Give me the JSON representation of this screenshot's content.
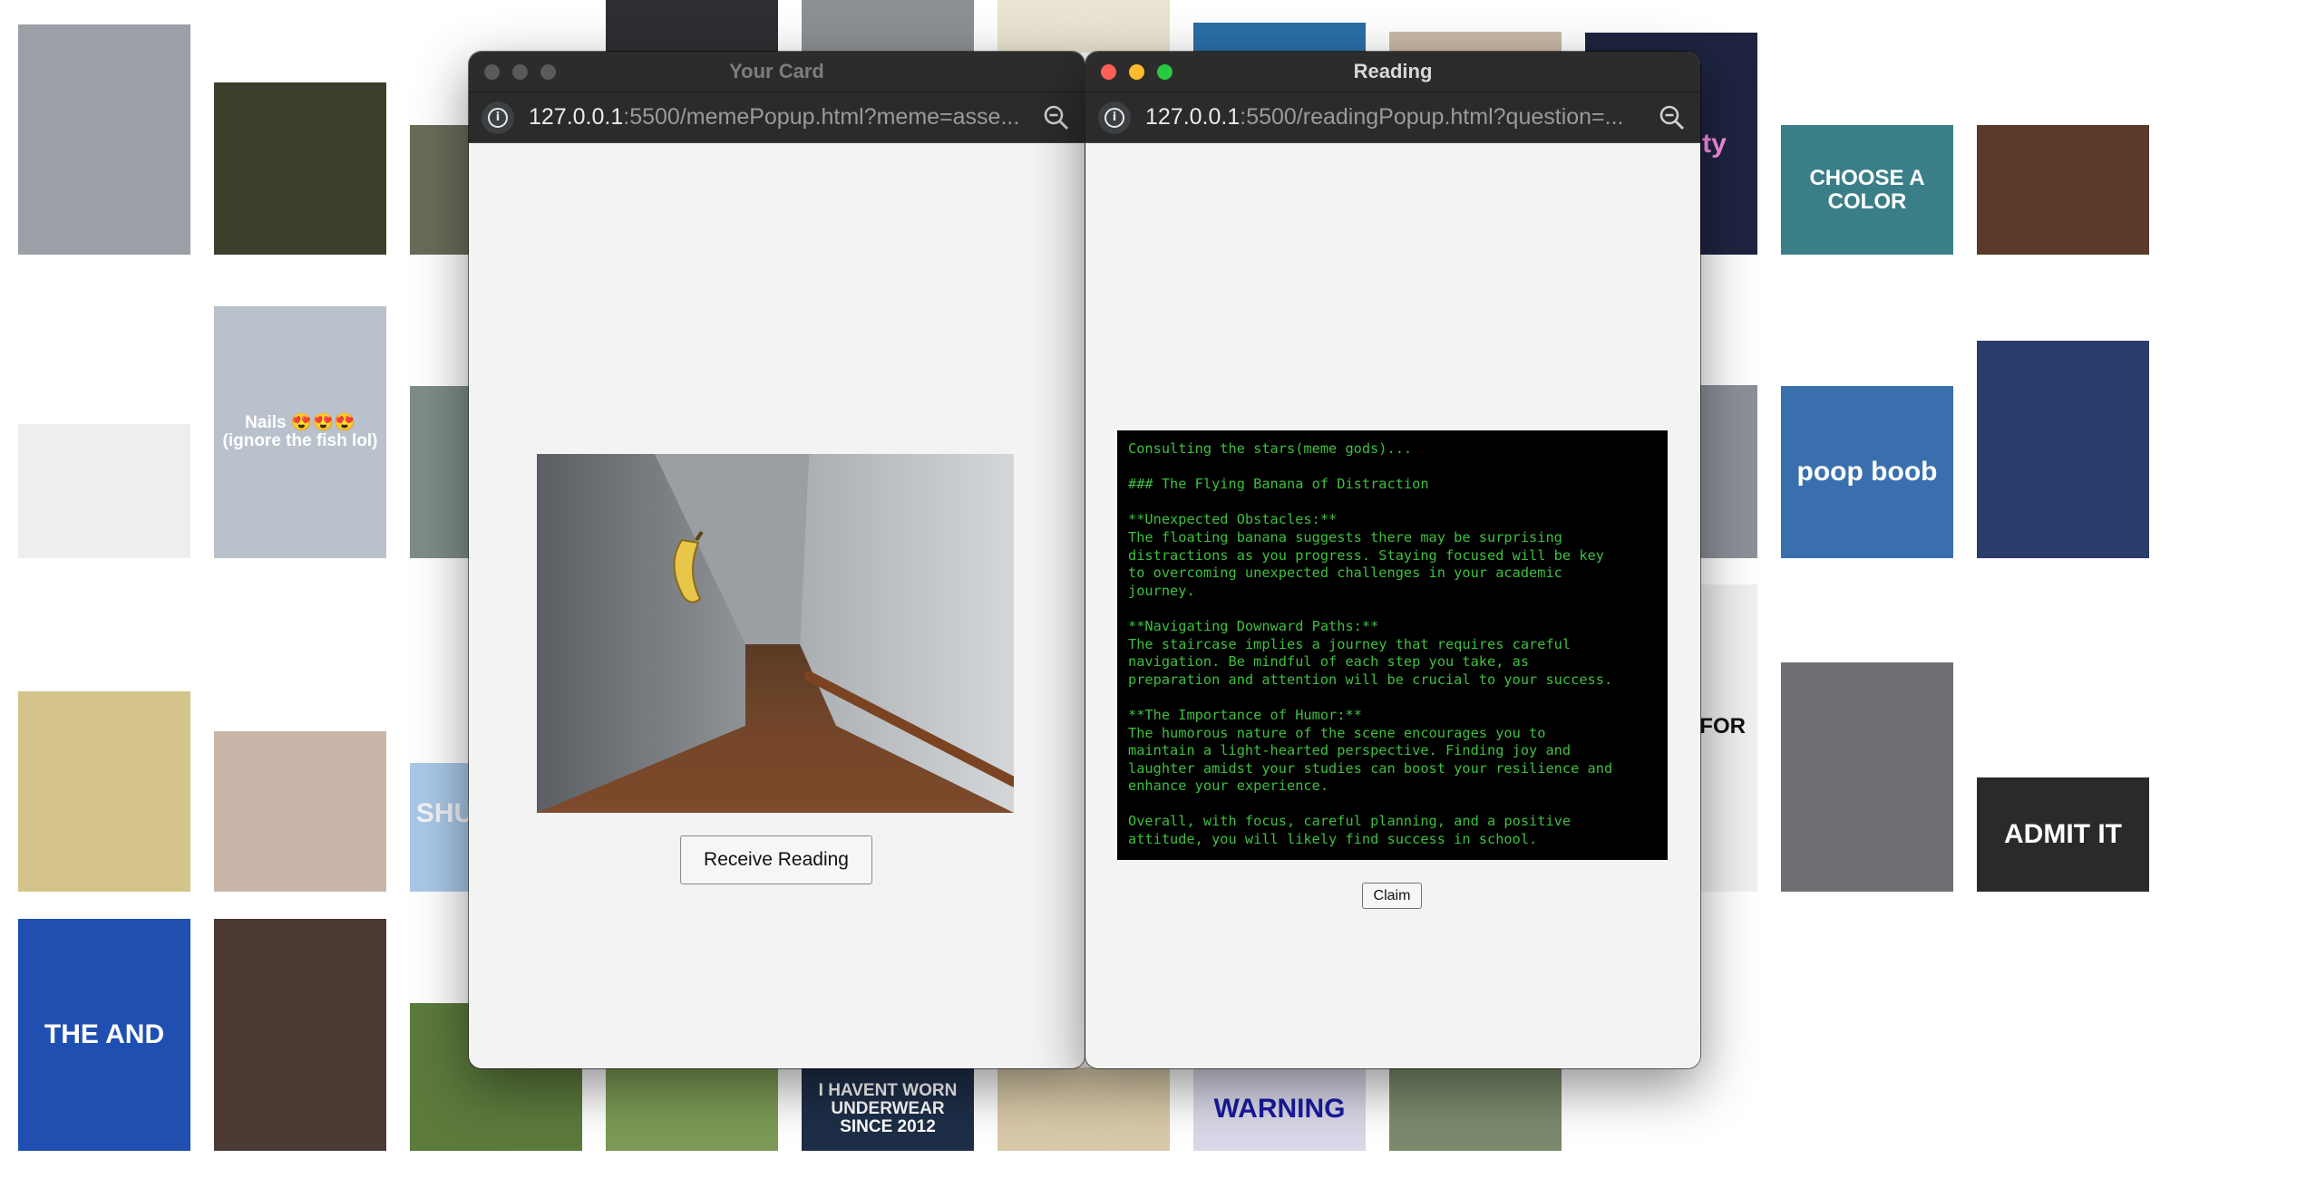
{
  "background_tiles": [
    {
      "caption": "",
      "bg": "#9aa0a6"
    },
    {
      "caption": "",
      "bg": "#3b3f2b"
    },
    {
      "caption": "",
      "bg": "#6b6b5a"
    },
    {
      "caption": "",
      "bg": "#2f2f33"
    },
    {
      "caption": "",
      "bg": "#8c8f94"
    },
    {
      "caption": "",
      "bg": "#e9e4d2"
    },
    {
      "caption": "",
      "bg": "#2a6fa8"
    },
    {
      "caption": "",
      "bg": "#c9b9a7"
    },
    {
      "caption": "Fart City",
      "bg": "#1e2440",
      "color": "#ff8fe6"
    },
    {
      "caption": "CHOOSE A COLOR",
      "bg": "#3a7f88",
      "color": "#ffffff"
    },
    {
      "caption": "",
      "bg": "#5a3a2a"
    },
    {
      "caption": "",
      "bg": "#eeeeee"
    },
    {
      "caption": "Nails 😍😍😍 (ignore the fish lol)",
      "bg": "#b9c2cc",
      "color": "#ffffff"
    },
    {
      "caption": "",
      "bg": "#7e8d89"
    },
    {
      "caption": "",
      "bg": "#8d9098"
    },
    {
      "caption": "poop boob",
      "bg": "#3a6fae",
      "color": "#ffffff"
    },
    {
      "caption": "",
      "bg": "#2a3d6b"
    },
    {
      "caption": "",
      "bg": "#d4c48a"
    },
    {
      "caption": "",
      "bg": "#c9b6a8"
    },
    {
      "caption": "SHUT YOUR UP",
      "bg": "#a9c8e8",
      "color": "#f4f4f4"
    },
    {
      "caption": "I'LL SING FOR YOU",
      "bg": "#efefef",
      "color": "#111111"
    },
    {
      "caption": "",
      "bg": "#6d6f72"
    },
    {
      "caption": "ADMIT IT",
      "bg": "#2a2a2a",
      "color": "#ffffff"
    },
    {
      "caption": "THE AND",
      "bg": "#1f4fb0",
      "color": "#ffffff"
    },
    {
      "caption": "",
      "bg": "#4a3a33"
    },
    {
      "caption": "",
      "bg": "#5c7a3c"
    },
    {
      "caption": "",
      "bg": "#7c9a55"
    },
    {
      "caption": "I HAVENT WORN UNDERWEAR SINCE 2012",
      "bg": "#1e2e48",
      "color": "#ffffff"
    },
    {
      "caption": "",
      "bg": "#d8c9a8"
    },
    {
      "caption": "WARNING",
      "bg": "#d8d8e8",
      "color": "#1a1aa0"
    },
    {
      "caption": "",
      "bg": "#7b8a6c"
    }
  ],
  "card_window": {
    "title": "Your Card",
    "url_host": "127.0.0.1",
    "url_rest": ":5500/memePopup.html?meme=asse...",
    "button_label": "Receive Reading"
  },
  "reading_window": {
    "title": "Reading",
    "url_host": "127.0.0.1",
    "url_rest": ":5500/readingPopup.html?question=...",
    "reading_text": "Consulting the stars(meme gods)...\n\n### The Flying Banana of Distraction\n\n**Unexpected Obstacles:**\nThe floating banana suggests there may be surprising\ndistractions as you progress. Staying focused will be key\nto overcoming unexpected challenges in your academic\njourney.\n\n**Navigating Downward Paths:**\nThe staircase implies a journey that requires careful\nnavigation. Be mindful of each step you take, as\npreparation and attention will be crucial to your success.\n\n**The Importance of Humor:**\nThe humorous nature of the scene encourages you to\nmaintain a light-hearted perspective. Finding joy and\nlaughter amidst your studies can boost your resilience and\nenhance your experience.\n\nOverall, with focus, careful planning, and a positive\nattitude, you will likely find success in school.",
    "button_label": "Claim"
  },
  "colors": {
    "terminal_bg": "#000000",
    "terminal_text": "#3fbf3f",
    "titlebar": "#2c2c2c",
    "traffic_close": "#ff5f57",
    "traffic_min": "#febc2e",
    "traffic_max": "#28c840"
  }
}
